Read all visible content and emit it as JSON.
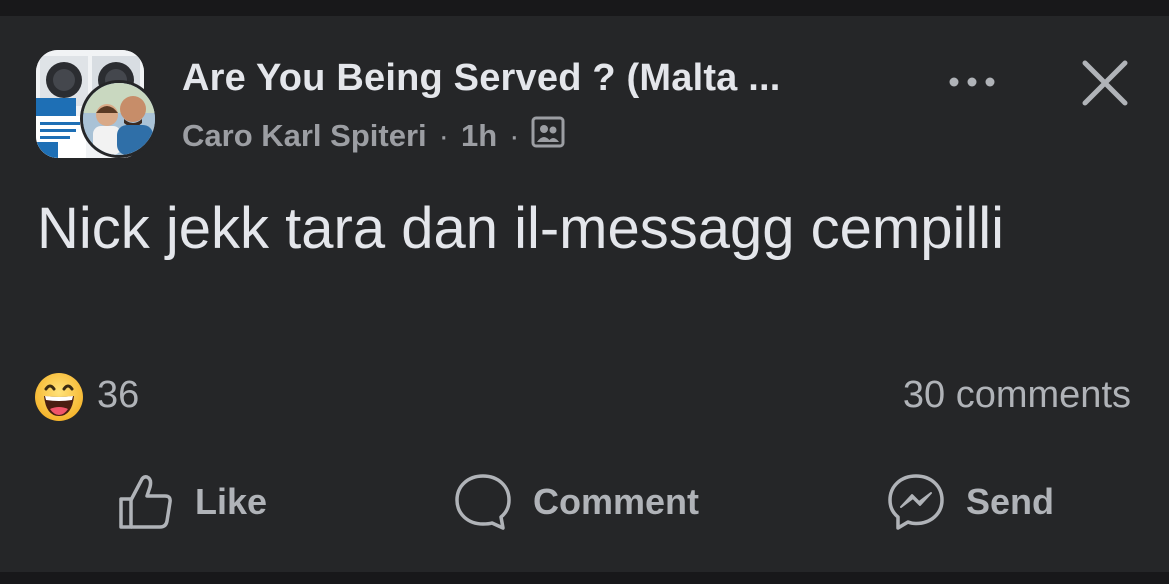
{
  "post": {
    "group_name": "Are You Being Served ? (Malta ...",
    "author": "Caro Karl Spiteri",
    "separator": "·",
    "time": "1h",
    "privacy_icon": "group-icon",
    "body": "Nick jekk tara dan il-messagg cempilli",
    "group_avatar_icon": "group-avatar-image",
    "user_avatar_icon": "user-avatar-image"
  },
  "header_actions": {
    "more_icon": "more-icon",
    "close_icon": "close-icon"
  },
  "stats": {
    "reaction_icon": "haha-reaction-icon",
    "reaction_count": "36",
    "comments": "30 comments"
  },
  "actions": {
    "like_label": "Like",
    "comment_label": "Comment",
    "send_label": "Send"
  },
  "colors": {
    "background": "#18181a",
    "card": "#252628",
    "primary_text": "#e4e6eb",
    "secondary_text": "#b0b3b8"
  }
}
